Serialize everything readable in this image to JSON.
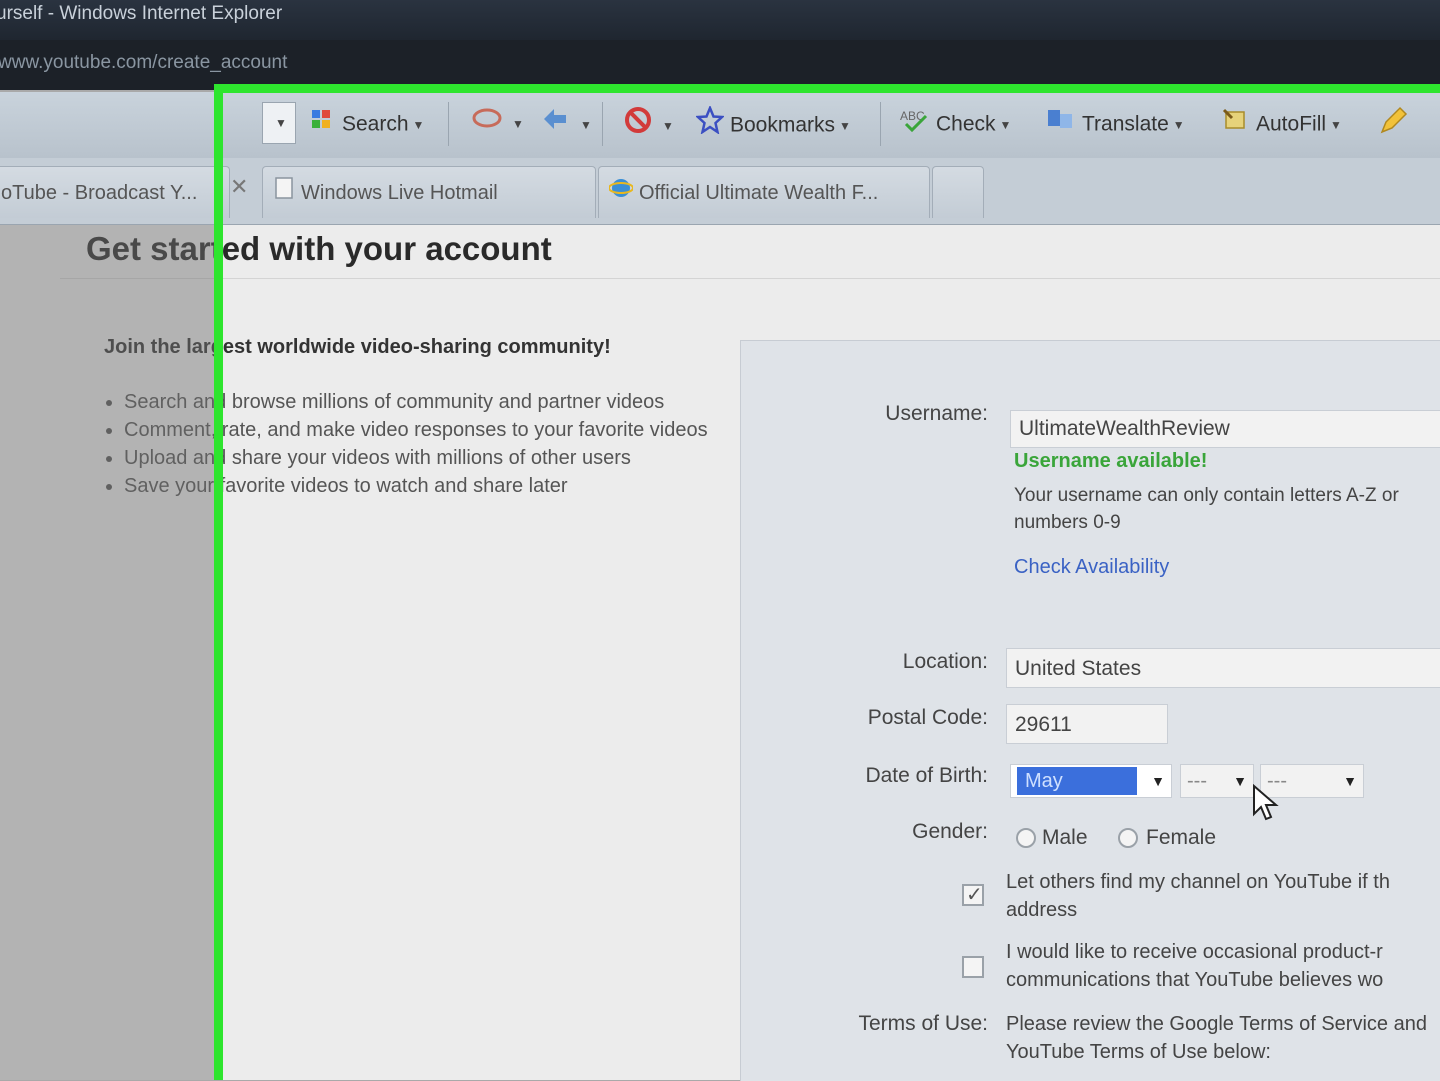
{
  "window": {
    "title": "urself - Windows Internet Explorer",
    "address": "www.youtube.com/create_account"
  },
  "toolbar": {
    "search_label": "Search",
    "bookmarks_label": "Bookmarks",
    "check_label": "Check",
    "translate_label": "Translate",
    "autofill_label": "AutoFill"
  },
  "tabs": [
    {
      "label": "oTube - Broadcast Y..."
    },
    {
      "label": "Windows Live Hotmail"
    },
    {
      "label": "Official Ultimate Wealth F..."
    }
  ],
  "page": {
    "heading": "Get started with your account",
    "intro": "Join the largest worldwide video-sharing community!",
    "benefits": [
      "Search and browse millions of community and partner videos",
      "Comment, rate, and make video responses to your favorite videos",
      "Upload and share your videos with millions of other users",
      "Save your favorite videos to watch and share later"
    ]
  },
  "form": {
    "username_label": "Username:",
    "username_value": "UltimateWealthReview",
    "username_status": "Username available!",
    "username_hint": "Your username can only contain letters A-Z or numbers 0-9",
    "check_availability": "Check Availability",
    "location_label": "Location:",
    "location_value": "United States",
    "postal_label": "Postal Code:",
    "postal_value": "29611",
    "dob_label": "Date of Birth:",
    "dob_month": "May",
    "dob_day": "---",
    "dob_year": "---",
    "gender_label": "Gender:",
    "gender_male": "Male",
    "gender_female": "Female",
    "channel_checkbox_text": "Let others find my channel on YouTube if th address",
    "optin_checkbox_text": "I would like to receive occasional product-r communications that YouTube believes wo",
    "terms_label": "Terms of Use:",
    "terms_text": "Please review the Google Terms of Service and YouTube Terms of Use below:"
  },
  "colors": {
    "highlight_green": "#2ee52e",
    "link_blue": "#3a62c4",
    "available_green": "#3aa53a"
  }
}
